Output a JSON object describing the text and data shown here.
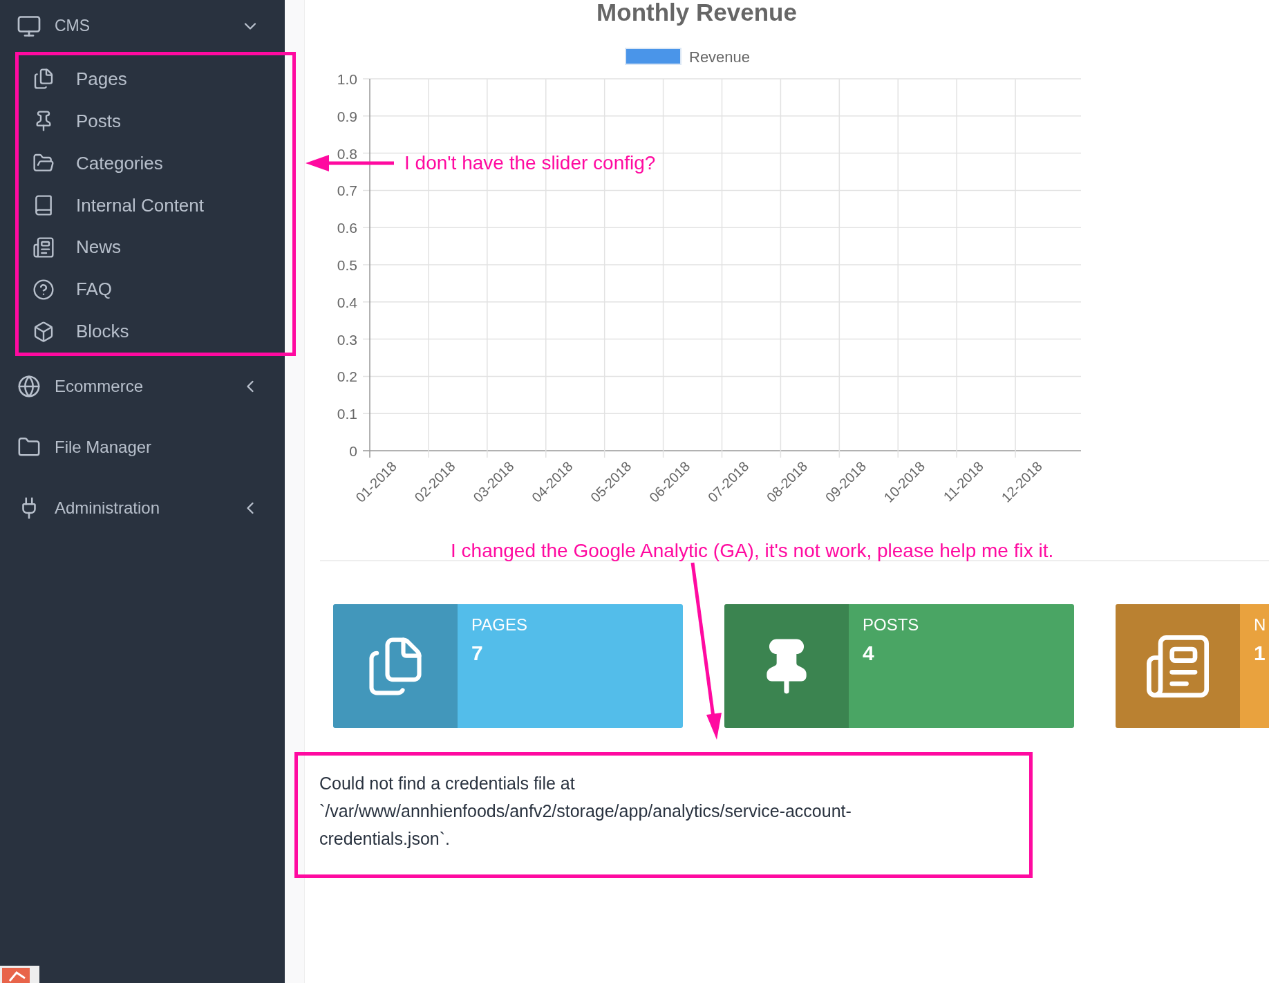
{
  "sidebar": {
    "items": [
      {
        "label": "CMS",
        "kind": "cms",
        "expanded": true,
        "children": [
          {
            "label": "Pages",
            "kind": "pages"
          },
          {
            "label": "Posts",
            "kind": "posts"
          },
          {
            "label": "Categories",
            "kind": "categories"
          },
          {
            "label": "Internal Content",
            "kind": "internal"
          },
          {
            "label": "News",
            "kind": "news"
          },
          {
            "label": "FAQ",
            "kind": "faq"
          },
          {
            "label": "Blocks",
            "kind": "blocks"
          }
        ]
      },
      {
        "label": "Ecommerce",
        "kind": "ecommerce",
        "expanded": false
      },
      {
        "label": "File Manager",
        "kind": "files"
      },
      {
        "label": "Administration",
        "kind": "admin",
        "expanded": false
      }
    ]
  },
  "chart": {
    "chart_data": {
      "type": "line",
      "title": "Monthly Revenue",
      "categories": [
        "01-2018",
        "02-2018",
        "03-2018",
        "04-2018",
        "05-2018",
        "06-2018",
        "07-2018",
        "08-2018",
        "09-2018",
        "10-2018",
        "11-2018",
        "12-2018"
      ],
      "series": [
        {
          "name": "Revenue",
          "color": "#4a95e9",
          "values": [
            null,
            null,
            null,
            null,
            null,
            null,
            null,
            null,
            null,
            null,
            null,
            null
          ]
        }
      ],
      "ylim": [
        0,
        1
      ],
      "grid": true,
      "yticks": [
        0,
        0.1,
        0.2,
        0.3,
        0.4,
        0.5,
        0.6,
        0.7,
        0.8,
        0.9,
        {
          "value": 1,
          "label": "1.0"
        }
      ]
    }
  },
  "cards": [
    {
      "kind": "pages",
      "label": "PAGES",
      "value": "7",
      "color": "#53bdea"
    },
    {
      "kind": "posts",
      "label": "POSTS",
      "value": "4",
      "color": "#4aa564"
    },
    {
      "kind": "news",
      "label": "N",
      "value": "1",
      "color": "#e9a23e"
    }
  ],
  "error": {
    "text": "Could not find a credentials file at `/var/www/annhienfoods/anfv2/storage/app/analytics/service-account-credentials.json`."
  },
  "annotations": [
    {
      "text": "I don't have the slider config?"
    },
    {
      "text": "I changed the Google Analytic (GA), it's not work, please help me fix it."
    }
  ]
}
